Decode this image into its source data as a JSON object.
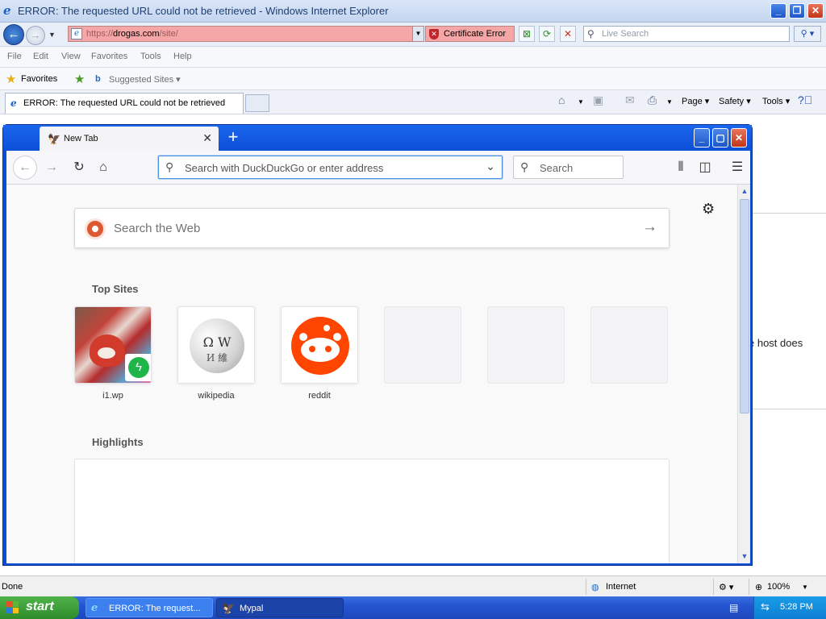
{
  "ie": {
    "title": "ERROR: The requested URL could not be retrieved - Windows Internet Explorer",
    "address_scheme": "https://",
    "address_host": "drogas.com",
    "address_path": "/site/",
    "certificate_error": "Certificate Error",
    "live_search_placeholder": "Live Search",
    "menu": [
      "File",
      "Edit",
      "View",
      "Favorites",
      "Tools",
      "Help"
    ],
    "favorites_label": "Favorites",
    "suggested_sites_label": "Suggested Sites",
    "tab_title": "ERROR: The requested URL could not be retrieved",
    "commands": {
      "page": "Page",
      "safety": "Safety",
      "tools": "Tools"
    },
    "content_snippet": "e host does",
    "status_text": "Done",
    "zone": "Internet",
    "zoom": "100%"
  },
  "taskbar": {
    "start_label": "start",
    "items": [
      {
        "label": "ERROR: The request..."
      },
      {
        "label": "Mypal"
      }
    ],
    "clock": "5:28 PM"
  },
  "mypal": {
    "tab_title": "New Tab",
    "urlbar_placeholder": "Search with DuckDuckGo or enter address",
    "searchbar_placeholder": "Search",
    "search_web_placeholder": "Search the Web",
    "top_sites_title": "Top Sites",
    "top_sites": [
      {
        "label": "i1.wp"
      },
      {
        "label": "wikipedia"
      },
      {
        "label": "reddit"
      },
      {
        "label": ""
      },
      {
        "label": ""
      },
      {
        "label": ""
      }
    ],
    "highlights_title": "Highlights"
  },
  "colors": {
    "xp_blue": "#0b4fd6",
    "cert_error_bg": "#f5a6a6",
    "reddit": "#ff4500",
    "start_green": "#3a9b35"
  }
}
